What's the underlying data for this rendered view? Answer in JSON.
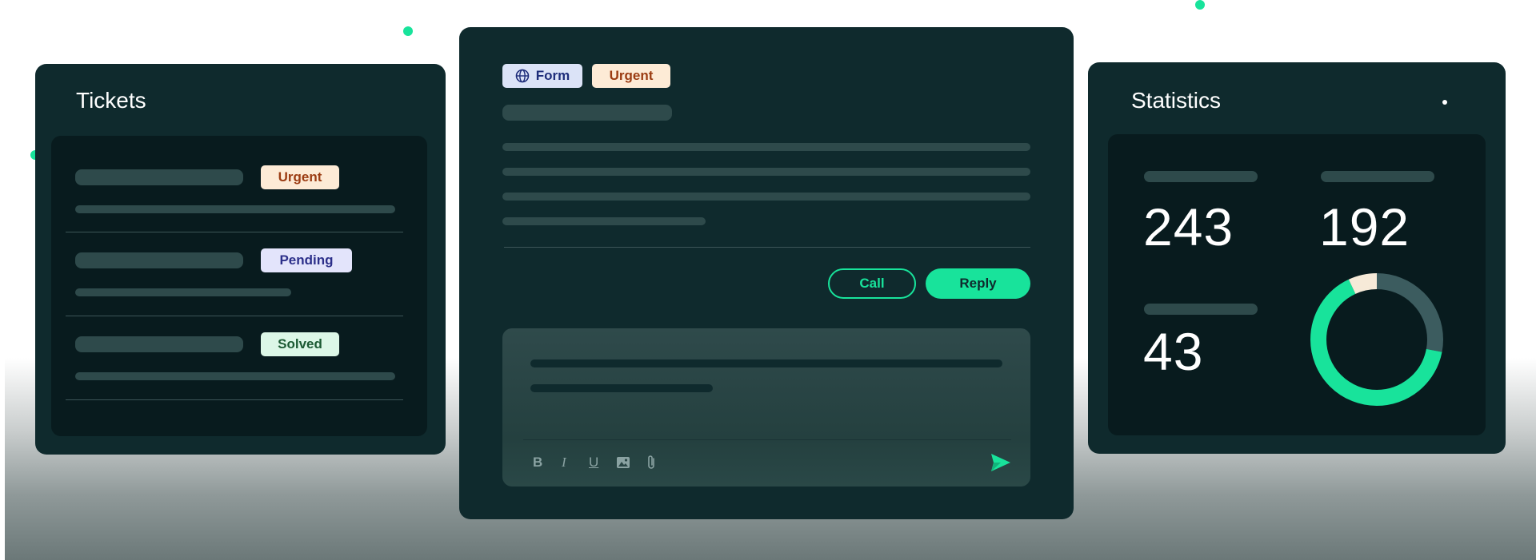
{
  "tickets": {
    "title": "Tickets",
    "rows": [
      {
        "status": "Urgent"
      },
      {
        "status": "Pending"
      },
      {
        "status": "Solved"
      }
    ]
  },
  "message": {
    "tags": {
      "channel": "Form",
      "priority": "Urgent"
    },
    "actions": {
      "call_label": "Call",
      "reply_label": "Reply"
    },
    "composer": {
      "tools": [
        "bold-icon",
        "italic-icon",
        "underline-icon",
        "image-icon",
        "attachment-icon"
      ],
      "send_icon": "send-icon"
    }
  },
  "statistics": {
    "title": "Statistics",
    "values": [
      "243",
      "192",
      "43"
    ],
    "donut": {
      "slices": [
        {
          "name": "green",
          "fraction": 0.65,
          "color": "#18e39b"
        },
        {
          "name": "dark",
          "fraction": 0.28,
          "color": "#3c5c5f"
        },
        {
          "name": "cream",
          "fraction": 0.07,
          "color": "#f6ead8"
        }
      ]
    }
  },
  "colors": {
    "accent": "#18e39b",
    "card": "#0f2a2d",
    "card_inner": "#081b1e"
  }
}
